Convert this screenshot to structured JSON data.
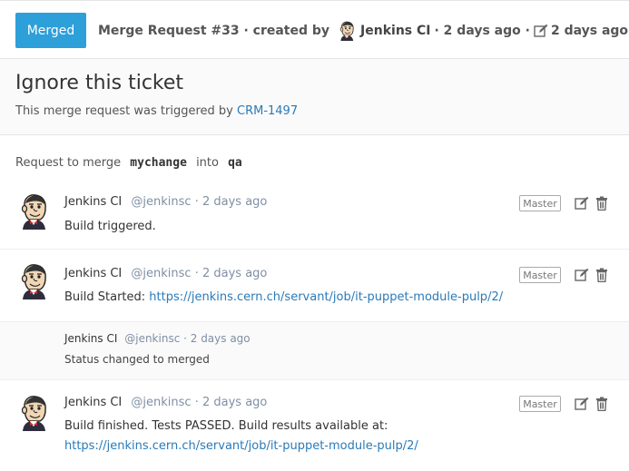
{
  "header": {
    "status_label": "Merged",
    "mr_title_prefix": "Merge Request #33 · created by",
    "author": "Jenkins CI",
    "created_ago": "· 2 days ago ·",
    "updated_ago": "2 days ago"
  },
  "title_box": {
    "title": "Ignore this ticket",
    "desc_prefix": "This merge request was triggered by",
    "ticket_link": "CRM-1497"
  },
  "merge_info": {
    "prefix": "Request to merge",
    "source_branch": "mychange",
    "into": "into",
    "target_branch": "qa"
  },
  "notes": [
    {
      "author": "Jenkins CI",
      "meta": "@jenkinsc · 2 days ago",
      "role": "Master",
      "text": "Build triggered."
    },
    {
      "author": "Jenkins CI",
      "meta": "@jenkinsc · 2 days ago",
      "role": "Master",
      "text_prefix": "Build Started:",
      "link": "https://jenkins.cern.ch/servant/job/it-puppet-module-pulp/2/"
    },
    {
      "author": "Jenkins CI",
      "meta": "@jenkinsc · 2 days ago",
      "text": "Status changed to merged"
    },
    {
      "author": "Jenkins CI",
      "meta": "@jenkinsc · 2 days ago",
      "role": "Master",
      "text_prefix": "Build finished. Tests PASSED. Build results available at:",
      "link": "https://jenkins.cern.ch/servant/job/it-puppet-module-pulp/2/"
    }
  ],
  "icons": {
    "avatar": "jenkins-avatar-icon",
    "edit": "edit-icon",
    "delete": "trash-icon"
  },
  "colors": {
    "status_bg": "#2d9fd9",
    "link": "#2a7ab8",
    "handle": "#7f8fa4"
  }
}
